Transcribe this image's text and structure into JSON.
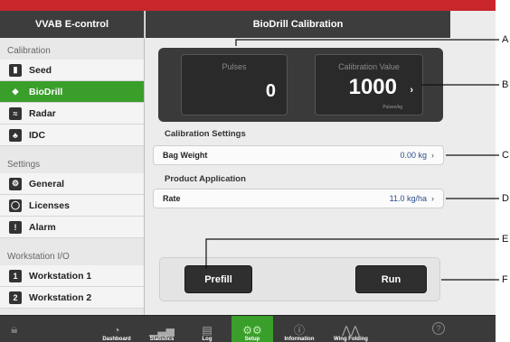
{
  "sidebar": {
    "title": "VVAB E-control",
    "sections": [
      {
        "label": "Calibration",
        "items": [
          {
            "label": "Seed",
            "icon": "seed-icon"
          },
          {
            "label": "BioDrill",
            "icon": "drop-icon",
            "active": true
          },
          {
            "label": "Radar",
            "icon": "radar-icon"
          },
          {
            "label": "IDC",
            "icon": "idc-icon"
          }
        ]
      },
      {
        "label": "Settings",
        "items": [
          {
            "label": "General",
            "icon": "gears-icon"
          },
          {
            "label": "Licenses",
            "icon": "license-icon"
          },
          {
            "label": "Alarm",
            "icon": "alarm-icon"
          }
        ]
      },
      {
        "label": "Workstation I/O",
        "items": [
          {
            "label": "Workstation 1",
            "icon": "workstation-1-icon"
          },
          {
            "label": "Workstation 2",
            "icon": "workstation-2-icon"
          }
        ]
      }
    ]
  },
  "main": {
    "title": "BioDrill Calibration",
    "pulses": {
      "label": "Pulses",
      "value": "0"
    },
    "calibration": {
      "label": "Calibration Value",
      "value": "1000",
      "unit": "Pulses/kg"
    },
    "calibration_settings": {
      "title": "Calibration Settings",
      "bag_weight_label": "Bag Weight",
      "bag_weight_value": "0.00 kg"
    },
    "product_application": {
      "title": "Product Application",
      "rate_label": "Rate",
      "rate_value": "11.0 kg/ha"
    },
    "buttons": {
      "prefill": "Prefill",
      "run": "Run"
    }
  },
  "tabbar": {
    "tabs": [
      {
        "label": "Dashboard",
        "icon": "dashboard-icon"
      },
      {
        "label": "Statistics",
        "icon": "statistics-icon"
      },
      {
        "label": "Log",
        "icon": "log-icon"
      },
      {
        "label": "Setup",
        "icon": "setup-gears-icon",
        "active": true
      },
      {
        "label": "Information",
        "icon": "info-icon"
      },
      {
        "label": "Wing Folding",
        "icon": "wing-folding-icon"
      }
    ]
  },
  "callouts": [
    "A",
    "B",
    "C",
    "D",
    "E",
    "F"
  ],
  "colors": {
    "brand_red": "#c8262a",
    "active_green": "#3a9e2b",
    "header_dark": "#3d3d3d"
  }
}
